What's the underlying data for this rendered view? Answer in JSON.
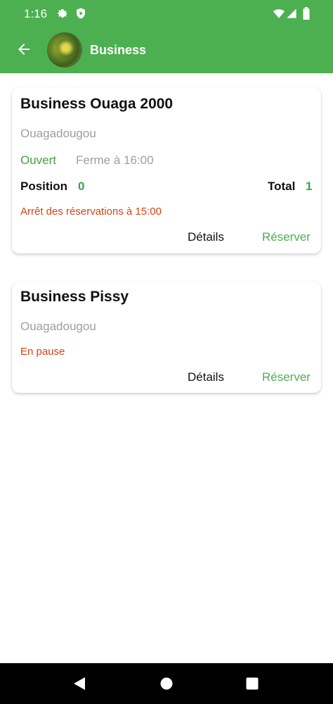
{
  "status_bar": {
    "time": "1:16",
    "icons": [
      "gear-icon",
      "shield-play-icon",
      "wifi-icon",
      "signal-icon",
      "battery-icon"
    ]
  },
  "app_bar": {
    "title": "Business",
    "background": "#4caf50"
  },
  "businesses": [
    {
      "name": "Business Ouaga 2000",
      "city": "Ouagadougou",
      "status": "Ouvert",
      "closing": "Ferme à 16:00",
      "position_label": "Position",
      "position_value": "0",
      "total_label": "Total",
      "total_value": "1",
      "notice": "Arrêt des réservations à 15:00",
      "details_label": "Détails",
      "reserve_label": "Réserver"
    },
    {
      "name": "Business Pissy",
      "city": "Ouagadougou",
      "notice": "En pause",
      "details_label": "Détails",
      "reserve_label": "Réserver"
    }
  ],
  "colors": {
    "accent_green": "#4caf50",
    "open_green": "#43a047",
    "warning_red": "#d84315",
    "muted_gray": "#9e9e9e"
  }
}
